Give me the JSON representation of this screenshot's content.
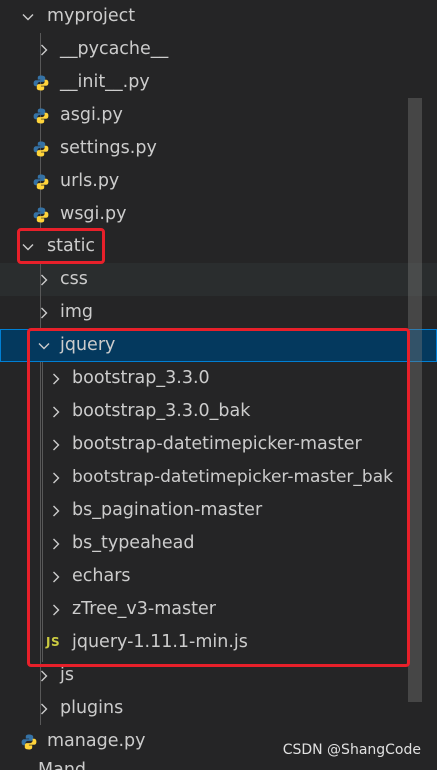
{
  "explorer": {
    "items": [
      {
        "label": "myproject",
        "type": "folder",
        "expanded": true
      },
      {
        "label": "__pycache__",
        "type": "folder",
        "expanded": false
      },
      {
        "label": "__init__.py",
        "type": "python-file"
      },
      {
        "label": "asgi.py",
        "type": "python-file"
      },
      {
        "label": "settings.py",
        "type": "python-file"
      },
      {
        "label": "urls.py",
        "type": "python-file"
      },
      {
        "label": "wsgi.py",
        "type": "python-file"
      },
      {
        "label": "static",
        "type": "folder",
        "expanded": true
      },
      {
        "label": "css",
        "type": "folder",
        "expanded": false
      },
      {
        "label": "img",
        "type": "folder",
        "expanded": false
      },
      {
        "label": "jquery",
        "type": "folder",
        "expanded": true,
        "selected": true
      },
      {
        "label": "bootstrap_3.3.0",
        "type": "folder",
        "expanded": false
      },
      {
        "label": "bootstrap_3.3.0_bak",
        "type": "folder",
        "expanded": false
      },
      {
        "label": "bootstrap-datetimepicker-master",
        "type": "folder",
        "expanded": false
      },
      {
        "label": "bootstrap-datetimepicker-master_bak",
        "type": "folder",
        "expanded": false
      },
      {
        "label": "bs_pagination-master",
        "type": "folder",
        "expanded": false
      },
      {
        "label": "bs_typeahead",
        "type": "folder",
        "expanded": false
      },
      {
        "label": "echars",
        "type": "folder",
        "expanded": false
      },
      {
        "label": "zTree_v3-master",
        "type": "folder",
        "expanded": false
      },
      {
        "label": "jquery-1.11.1-min.js",
        "type": "js-file",
        "badge": "JS"
      },
      {
        "label": "js",
        "type": "folder",
        "expanded": false
      },
      {
        "label": "plugins",
        "type": "folder",
        "expanded": false
      },
      {
        "label": "manage.py",
        "type": "python-file"
      }
    ],
    "cutoff_label": "Mand..."
  },
  "watermark": "CSDN @ShangCode",
  "colors": {
    "background": "#252526",
    "text": "#cccccc",
    "selection": "#04395e",
    "highlight_box": "#e8202a",
    "python_icon_blue": "#3572a5",
    "python_icon_yellow": "#ffd43b",
    "js_badge": "#cbcb41"
  }
}
